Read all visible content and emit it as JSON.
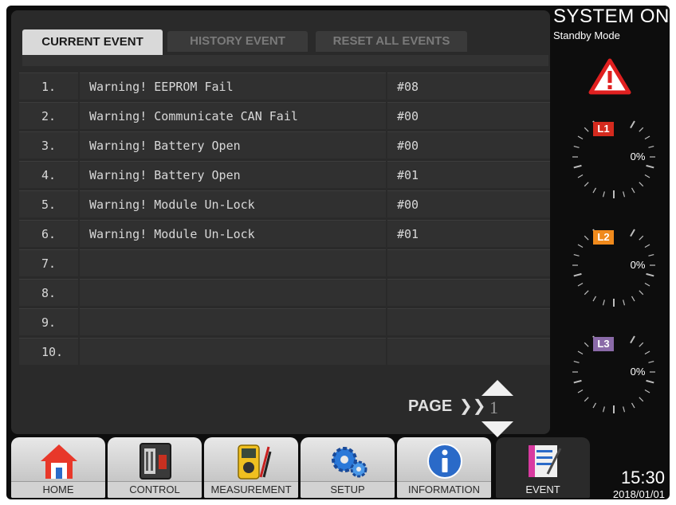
{
  "tabs": {
    "current": "CURRENT EVENT",
    "history": "HISTORY EVENT",
    "reset": "RESET ALL EVENTS"
  },
  "events": [
    {
      "num": "1.",
      "message": "Warning! EEPROM Fail",
      "code": "#08"
    },
    {
      "num": "2.",
      "message": "Warning! Communicate CAN Fail",
      "code": "#00"
    },
    {
      "num": "3.",
      "message": "Warning! Battery Open",
      "code": "#00"
    },
    {
      "num": "4.",
      "message": "Warning! Battery Open",
      "code": "#01"
    },
    {
      "num": "5.",
      "message": "Warning! Module Un-Lock",
      "code": "#00"
    },
    {
      "num": "6.",
      "message": "Warning! Module Un-Lock",
      "code": "#01"
    },
    {
      "num": "7.",
      "message": "",
      "code": ""
    },
    {
      "num": "8.",
      "message": "",
      "code": ""
    },
    {
      "num": "9.",
      "message": "",
      "code": ""
    },
    {
      "num": "10.",
      "message": "",
      "code": ""
    }
  ],
  "pager": {
    "label": "PAGE",
    "chevron": "❯❯",
    "current": "1"
  },
  "status": {
    "title": "SYSTEM ON",
    "mode": "Standby Mode",
    "alarm_icon": "warning-triangle-icon",
    "alarm_color": "#e02020"
  },
  "gauges": [
    {
      "label": "L1",
      "value": "0%",
      "color": "#d42a1e"
    },
    {
      "label": "L2",
      "value": "0%",
      "color": "#f08a1c"
    },
    {
      "label": "L3",
      "value": "0%",
      "color": "#8a6aa8"
    }
  ],
  "nav": {
    "home": "HOME",
    "control": "CONTROL",
    "measurement": "MEASUREMENT",
    "setup": "SETUP",
    "information": "INFORMATION",
    "event": "EVENT"
  },
  "clock": {
    "time": "15:30",
    "date": "2018/01/01"
  }
}
